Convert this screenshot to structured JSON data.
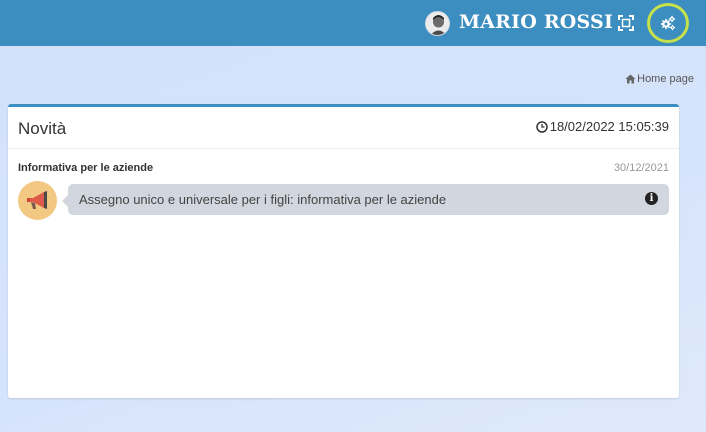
{
  "header": {
    "user_name": "MARIO ROSSI",
    "bar_color": "#3c8dc0",
    "icons": [
      "avatar-icon",
      "fullscreen-icon",
      "settings-gears-icon"
    ],
    "settings_highlight_color": "#c6e14a"
  },
  "breadcrumb": {
    "icon": "home-icon",
    "label": "Home page"
  },
  "panel": {
    "title": "Novità",
    "clock_icon": "clock-icon",
    "datetime": "18/02/2022 15:05:39",
    "news": [
      {
        "title": "Informativa per le aziende",
        "date": "30/12/2021",
        "icon": "megaphone-icon",
        "text": "Assegno unico e universale per i figli: informativa per le aziende",
        "info_icon": "info-icon",
        "info_glyph": "i"
      }
    ]
  }
}
